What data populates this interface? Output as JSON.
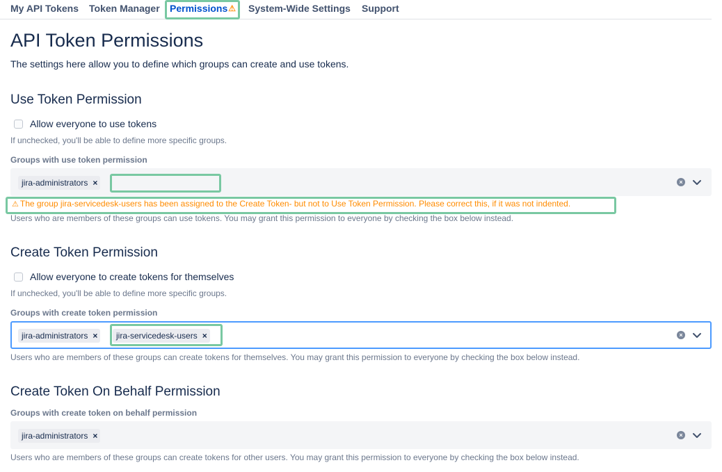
{
  "nav": {
    "tabs": [
      {
        "label": "My API Tokens"
      },
      {
        "label": "Token Manager"
      },
      {
        "label": "Permissions",
        "active": true,
        "warning_icon": "warning-icon"
      },
      {
        "label": "System-Wide Settings"
      },
      {
        "label": "Support"
      }
    ]
  },
  "page": {
    "title": "API Token Permissions",
    "intro": "The settings here allow you to define which groups can create and use tokens."
  },
  "use_token": {
    "heading": "Use Token Permission",
    "checkbox_label": "Allow everyone to use tokens",
    "checkbox_checked": false,
    "checkbox_help": "If unchecked, you'll be able to define more specific groups.",
    "field_label": "Groups with use token permission",
    "groups": [
      "jira-administrators"
    ],
    "remove_glyph": "×",
    "warning": "The group jira-servicedesk-users has been assigned to the Create Token- but not to Use Token Permission. Please correct this, if it was not indented.",
    "warning_glyph": "⚠",
    "help": "Users who are members of these groups can use tokens. You may grant this permission to everyone by checking the box below instead."
  },
  "create_token": {
    "heading": "Create Token Permission",
    "checkbox_label": "Allow everyone to create tokens for themselves",
    "checkbox_checked": false,
    "checkbox_help": "If unchecked, you'll be able to define more specific groups.",
    "field_label": "Groups with create token permission",
    "groups": [
      "jira-administrators",
      "jira-servicedesk-users"
    ],
    "remove_glyph": "×",
    "help": "Users who are members of these groups can create tokens for themselves. You may grant this permission to everyone by checking the box below instead."
  },
  "create_on_behalf": {
    "heading": "Create Token On Behalf Permission",
    "field_label": "Groups with create token on behalf permission",
    "groups": [
      "jira-administrators"
    ],
    "remove_glyph": "×",
    "help": "Users who are members of these groups can create tokens for other users. You may grant this permission to everyone by checking the box below instead."
  },
  "icons": {
    "clear": "×",
    "warning": "⚠"
  },
  "colors": {
    "accent": "#0052cc",
    "warning": "#ff8b00",
    "highlight": "#79c8a2",
    "focus": "#4c9aff"
  }
}
